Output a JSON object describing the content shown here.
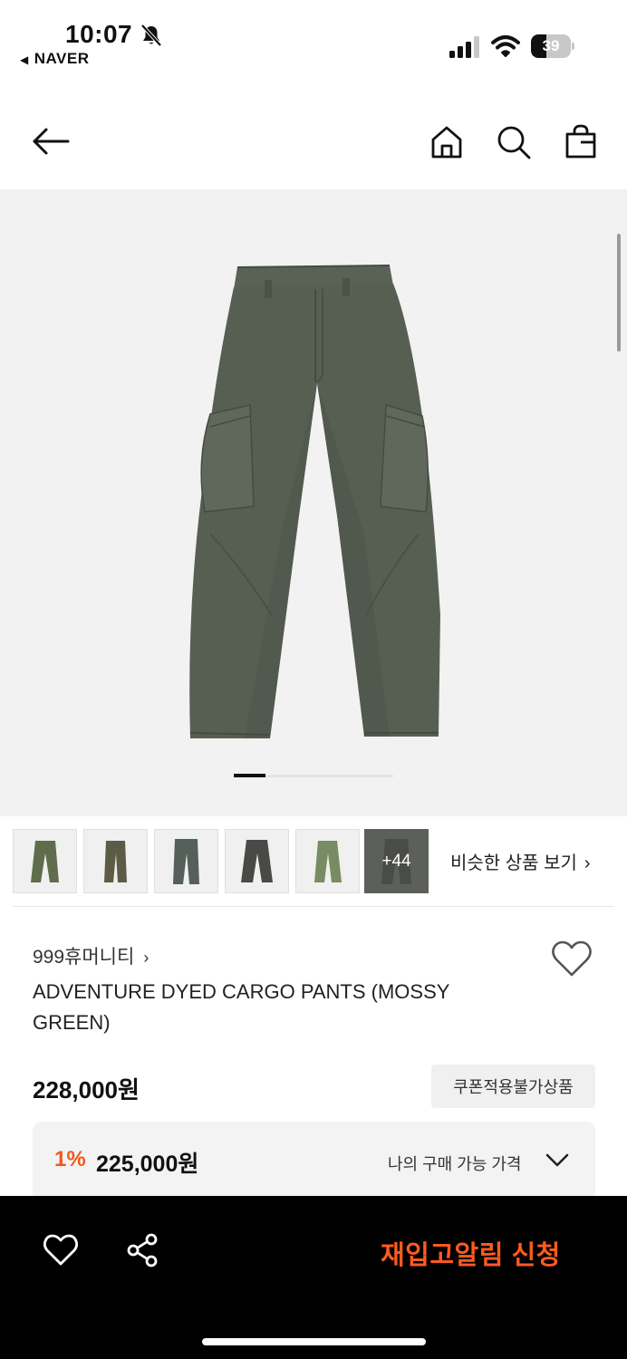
{
  "status_bar": {
    "time": "10:07",
    "back_app": "NAVER",
    "battery": "39",
    "battery_level": 0.39
  },
  "header": {
    "icons": [
      "back-arrow-icon",
      "home-icon",
      "search-icon",
      "shopping-bag-icon"
    ]
  },
  "gallery": {
    "current_page_fraction": 0.2,
    "thumbnails": [
      {
        "icon": "pants-thumbnail",
        "color": "#5f6d4d"
      },
      {
        "icon": "pants-thumbnail",
        "color": "#5c5b45"
      },
      {
        "icon": "pants-thumbnail",
        "color": "#55605a"
      },
      {
        "icon": "pants-thumbnail",
        "color": "#484a46"
      },
      {
        "icon": "pants-thumbnail",
        "color": "#778c62"
      }
    ],
    "more_label": "+44",
    "similar_label": "비슷한 상품 보기"
  },
  "product": {
    "brand": "999휴머니티",
    "title": "ADVENTURE DYED CARGO PANTS (MOSSY GREEN)",
    "price": "228,000원",
    "coupon_label": "쿠폰적용불가상품",
    "discount_percent": "1%",
    "my_price": "225,000원",
    "my_price_label": "나의 구매 가능 가격"
  },
  "bottom_bar": {
    "restock_label": "재입고알림 신청"
  },
  "colors": {
    "accent": "#ff5a1f",
    "discount": "#ef5a1a",
    "pants_main": "#575f53"
  }
}
